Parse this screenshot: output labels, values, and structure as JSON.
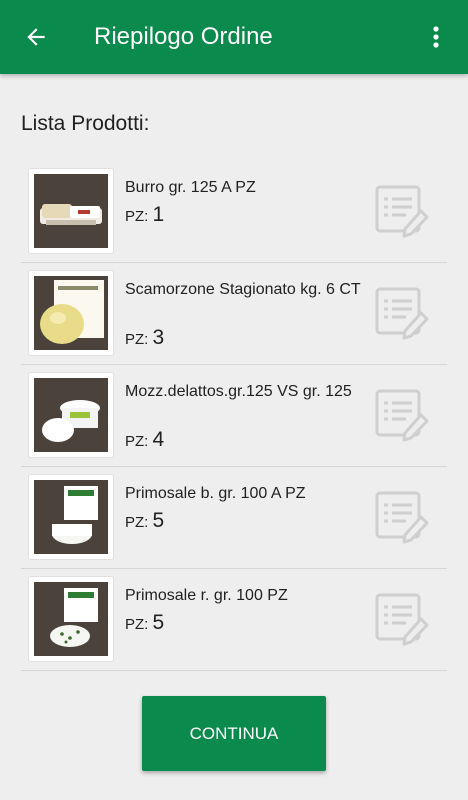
{
  "appbar": {
    "title": "Riepilogo Ordine",
    "back_icon": "arrow-left-icon",
    "menu_icon": "more-vert-icon",
    "color": "#0b8a4e"
  },
  "section_title": "Lista Prodotti:",
  "quantity_label": "PZ:",
  "products": [
    {
      "name": "Burro gr. 125 A PZ",
      "quantity": "1"
    },
    {
      "name": "Scamorzone Stagionato kg. 6 CT",
      "quantity": "3"
    },
    {
      "name": "Mozz.delattos.gr.125 VS gr. 125",
      "quantity": "4"
    },
    {
      "name": "Primosale b. gr. 100 A PZ",
      "quantity": "5"
    },
    {
      "name": "Primosale r. gr. 100  PZ",
      "quantity": "5"
    }
  ],
  "edit_icon": "edit-document-icon",
  "continue_label": "CONTINUA"
}
